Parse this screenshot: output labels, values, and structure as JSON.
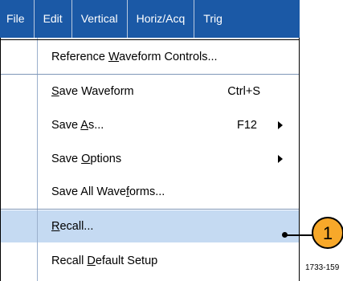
{
  "menubar": {
    "items": [
      {
        "label": "File"
      },
      {
        "label": "Edit"
      },
      {
        "label": "Vertical"
      },
      {
        "label": "Horiz/Acq"
      },
      {
        "label": "Trig"
      }
    ]
  },
  "menu": {
    "items": [
      {
        "pre": "Reference ",
        "ul": "W",
        "post": "aveform Controls...",
        "shortcut": "",
        "submenu": false
      },
      {
        "pre": "",
        "ul": "S",
        "post": "ave Waveform",
        "shortcut": "Ctrl+S",
        "submenu": false
      },
      {
        "pre": "Save ",
        "ul": "A",
        "post": "s...",
        "shortcut": "F12",
        "submenu": true
      },
      {
        "pre": "Save ",
        "ul": "O",
        "post": "ptions",
        "shortcut": "",
        "submenu": true
      },
      {
        "pre": "Save All Wave",
        "ul": "f",
        "post": "orms...",
        "shortcut": "",
        "submenu": false
      },
      {
        "pre": "",
        "ul": "R",
        "post": "ecall...",
        "shortcut": "",
        "submenu": false
      },
      {
        "pre": "Recall ",
        "ul": "D",
        "post": "efault Setup",
        "shortcut": "",
        "submenu": false
      }
    ]
  },
  "callout": {
    "number": "1"
  },
  "figure_code": "1733-159",
  "colors": {
    "menubar_bg": "#1b59a6",
    "highlight": "#c5daf2",
    "callout": "#f7a82a"
  }
}
